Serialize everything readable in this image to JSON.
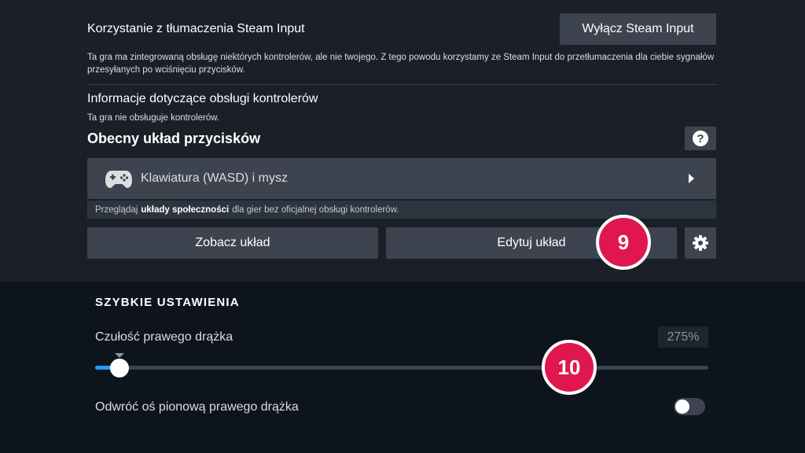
{
  "steam_input": {
    "title": "Korzystanie z tłumaczenia Steam Input",
    "disable_button": "Wyłącz Steam Input",
    "description": "Ta gra ma zintegrowaną obsługę niektórych kontrolerów, ale nie twojego. Z tego powodu korzystamy ze Steam Input do przetłumaczenia dla ciebie sygnałów przesyłanych po wciśnięciu przycisków."
  },
  "controller_info": {
    "title": "Informacje dotyczące obsługi kontrolerów",
    "description": "Ta gra nie obsługuje kontrolerów."
  },
  "layout": {
    "title": "Obecny układ przycisków",
    "help_glyph": "?",
    "current": "Klawiatura (WASD) i mysz",
    "community_prefix": "Przeglądaj",
    "community_link": "układy społeczności",
    "community_suffix": "dla gier bez oficjalnej obsługi kontrolerów.",
    "view_button": "Zobacz układ",
    "edit_button": "Edytuj układ"
  },
  "badges": {
    "edit_badge": "9",
    "slider_badge": "10",
    "color": "#e0174e"
  },
  "quick_settings": {
    "title": "SZYBKIE USTAWIENIA",
    "sensitivity_label": "Czułość prawego drążka",
    "sensitivity_value": "275%",
    "sensitivity_fraction": 0.04,
    "invert_label": "Odwróć oś pionową prawego drążka",
    "invert_enabled": false
  },
  "colors": {
    "accent": "#1a9fff",
    "button_bg": "#3d4450",
    "panel_bg": "#1b2028",
    "page_bg": "#0e141b"
  }
}
